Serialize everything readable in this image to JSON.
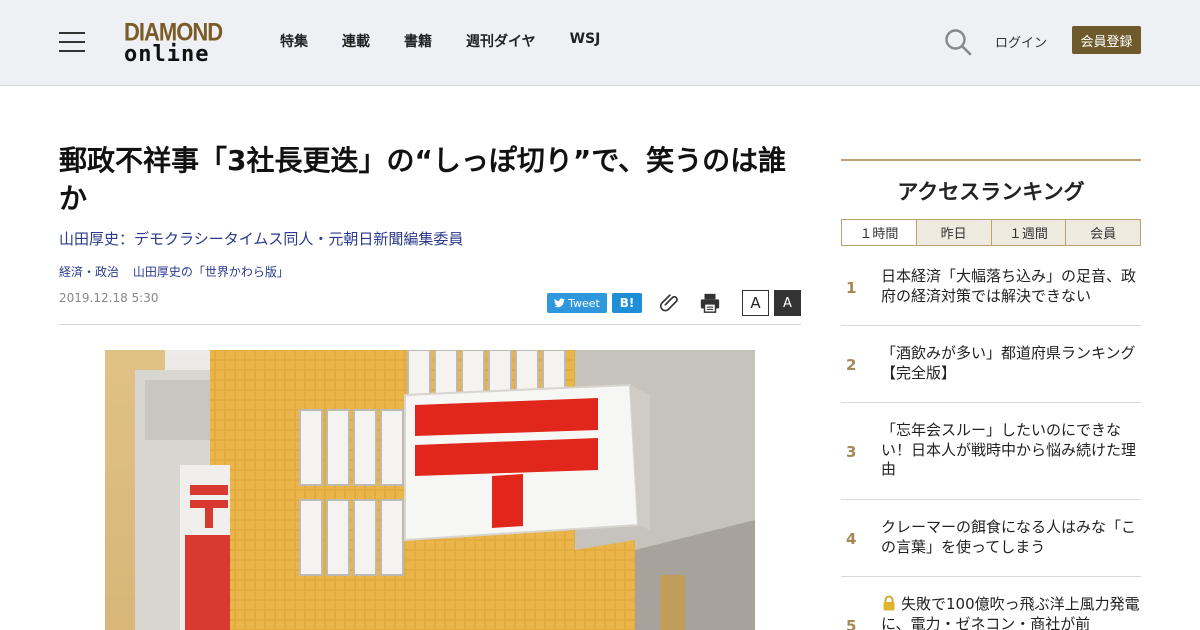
{
  "header": {
    "logo_line1": "DIAMOND",
    "logo_line2": "online",
    "nav": [
      "特集",
      "連載",
      "書籍",
      "週刊ダイヤ",
      "WSJ"
    ],
    "login_label": "ログイン",
    "register_label": "会員登録"
  },
  "article": {
    "title": "郵政不祥事「3社長更迭」の“しっぽ切り”で、笑うのは誰か",
    "author": "山田厚史：デモクラシータイムス同人・元朝日新聞編集委員",
    "categories": [
      "経済・政治",
      "山田厚史の「世界かわら版」"
    ],
    "date": "2019.12.18 5:30",
    "tweet_label": "Tweet",
    "hatena_label": "B!",
    "font_small": "A",
    "font_large": "A"
  },
  "ranking": {
    "title": "アクセスランキング",
    "tabs": [
      "１時間",
      "昨日",
      "１週間",
      "会員"
    ],
    "items": [
      {
        "num": "1",
        "text": "日本経済「大幅落ち込み」の足音、政府の経済対策では解決できない"
      },
      {
        "num": "2",
        "text": "「酒飲みが多い」都道府県ランキング【完全版】"
      },
      {
        "num": "3",
        "text": "「忘年会スルー」したいのにできない！日本人が戦時中から悩み続けた理由"
      },
      {
        "num": "4",
        "text": "クレーマーの餌食になる人はみな「この言葉」を使ってしまう"
      },
      {
        "num": "5",
        "text": "失敗で100億吹っ飛ぶ洋上風力発電に、電力・ゼネコン・商社が前"
      }
    ]
  },
  "colors": {
    "accent_gold": "#b9a373",
    "register_bg": "#6e5a2b",
    "link_blue": "#2b3a8c",
    "tweet_blue": "#2f98dc",
    "post_red": "#e1261c"
  }
}
